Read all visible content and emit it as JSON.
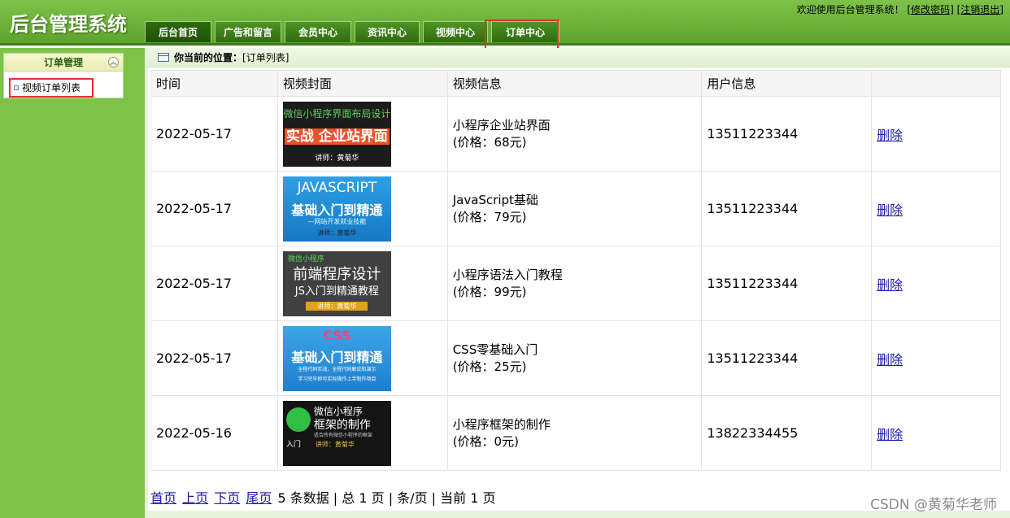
{
  "header": {
    "app_title": "后台管理系统",
    "welcome_text": "欢迎使用后台管理系统！",
    "change_password": "[修改密码]",
    "logout": "[注销退出]",
    "tabs": [
      {
        "label": "后台首页"
      },
      {
        "label": "广告和留言"
      },
      {
        "label": "会员中心"
      },
      {
        "label": "资讯中心"
      },
      {
        "label": "视频中心"
      },
      {
        "label": "订单中心"
      }
    ],
    "active_tab": "后台首页",
    "highlighted_tab": "订单中心"
  },
  "sidebar": {
    "panel_title": "订单管理",
    "items": [
      {
        "label": "视频订单列表"
      }
    ]
  },
  "breadcrumb": {
    "prefix": "你当前的位置：",
    "location": "[订单列表]"
  },
  "table": {
    "headers": [
      "时间",
      "视频封面",
      "视频信息",
      "用户信息",
      ""
    ],
    "rows": [
      {
        "date": "2022-05-17",
        "cover": {
          "lines": [
            "微信小程序界面布局设计",
            "实战 企业站界面",
            "讲师：黄菊华"
          ]
        },
        "title": "小程序企业站界面",
        "price": "(价格：68元)",
        "user": "13511223344",
        "action": "删除"
      },
      {
        "date": "2022-05-17",
        "cover": {
          "lines": [
            "JAVASCRIPT",
            "基础入门到精通",
            "—网站开发就业技能",
            "讲师：黄菊华"
          ]
        },
        "title": "JavaScript基础",
        "price": "(价格：79元)",
        "user": "13511223344",
        "action": "删除"
      },
      {
        "date": "2022-05-17",
        "cover": {
          "lines": [
            "微信小程序",
            "前端程序设计",
            "JS入门到精通教程",
            "讲师：黄菊华"
          ]
        },
        "title": "小程序语法入门教程",
        "price": "(价格：99元)",
        "user": "13511223344",
        "action": "删除"
      },
      {
        "date": "2022-05-17",
        "cover": {
          "lines": [
            "CSS",
            "基础入门到精通",
            "全程代码实战，全程代码解说和演示",
            "学习完毕即可实际操作上手制作项目"
          ]
        },
        "title": "CSS零基础入门",
        "price": "(价格：25元)",
        "user": "13511223344",
        "action": "删除"
      },
      {
        "date": "2022-05-16",
        "cover": {
          "lines": [
            "微信小程序",
            "框架的制作",
            "适合所有微信小程序的框架",
            "入门",
            "讲师：黄菊华"
          ]
        },
        "title": "小程序框架的制作",
        "price": "(价格：0元)",
        "user": "13822334455",
        "action": "删除"
      }
    ]
  },
  "pager": {
    "first": "首页",
    "prev": "上页",
    "next": "下页",
    "last": "尾页",
    "summary": "5 条数据 | 总 1 页 | 条/页 | 当前 1 页"
  },
  "watermark": "CSDN @黄菊华老师"
}
